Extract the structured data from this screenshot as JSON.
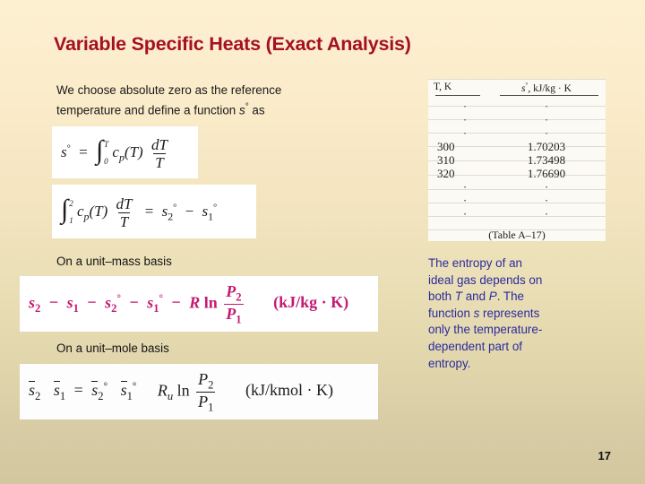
{
  "slide": {
    "title": "Variable Specific Heats (Exact Analysis)",
    "page_number": "17",
    "colors": {
      "title": "#a51022",
      "background_top": "#fdf0d0",
      "background_bottom": "#d2c79f",
      "magenta_equation": "#c31a72",
      "blue_text": "#2b2b9e"
    }
  },
  "intro": {
    "line1": "We choose absolute zero as the reference",
    "line2_pre": "temperature and define a function ",
    "line2_sym": "s",
    "line2_sup": "°",
    "line2_post": " as"
  },
  "equations": {
    "eq1": {
      "lhs": "s",
      "lhs_sup": "°",
      "equals": "=",
      "integral": "∫",
      "upper_limit": "T",
      "lower_limit": "0",
      "integrand": "c",
      "integrand_sub": "p",
      "integrand_arg": "(T)",
      "frac_num": "dT",
      "frac_den": "T"
    },
    "eq2": {
      "integral": "∫",
      "upper_limit": "2",
      "lower_limit": "1",
      "integrand": "c",
      "integrand_sub": "p",
      "integrand_arg": "(T)",
      "frac_num": "dT",
      "frac_den": "T",
      "equals": "=",
      "rhs1": "s",
      "rhs1_sub": "2",
      "rhs1_sup": "°",
      "minus": "−",
      "rhs2": "s",
      "rhs2_sub": "1",
      "rhs2_sup": "°"
    },
    "eq3": {
      "t1": "s",
      "t1_sub": "2",
      "op1": "−",
      "t2": "s",
      "t2_sub": "1",
      "op2": "−",
      "t3": "s",
      "t3_sub": "2",
      "t3_sup": "°",
      "op3": "−",
      "t4": "s",
      "t4_sub": "1",
      "t4_sup": "°",
      "op4": "−",
      "R": "R",
      "ln": "ln",
      "frac_num": "P",
      "frac_num_sub": "2",
      "frac_den": "P",
      "frac_den_sub": "1",
      "units": "(kJ/kg · K)"
    },
    "eq4": {
      "t1": "s",
      "t1_sub": "2",
      "op1": "",
      "t2": "s",
      "t2_sub": "1",
      "op2": "=",
      "t3": "s",
      "t3_sub": "2",
      "t3_sup": "°",
      "op3": "",
      "t4": "s",
      "t4_sub": "1",
      "t4_sup": "°",
      "R": "R",
      "R_sub": "u",
      "ln": "ln",
      "frac_num": "P",
      "frac_num_sub": "2",
      "frac_den": "P",
      "frac_den_sub": "1",
      "units": "(kJ/kmol · K)"
    }
  },
  "labels": {
    "unit_mass": "On a unit–mass basis",
    "unit_mole": "On a unit–mole basis"
  },
  "table": {
    "header": {
      "col1": "T, K",
      "col2_sym": "s",
      "col2_sup": "°",
      "col2_rest": ", kJ/kg · K"
    },
    "dots": "·",
    "rows": [
      {
        "t": "300",
        "s": "1.70203"
      },
      {
        "t": "310",
        "s": "1.73498"
      },
      {
        "t": "320",
        "s": "1.76690"
      }
    ],
    "caption": "(Table A–17)"
  },
  "blue_note": {
    "l1": "The entropy of an",
    "l2": "ideal gas depends on",
    "l3_pre": "both ",
    "l3_t": "T",
    "l3_mid": " and ",
    "l3_p": "P",
    "l3_post": ". The",
    "l4_pre": "function ",
    "l4_s": "s",
    "l4_post": " represents",
    "l5": "only the temperature-",
    "l6": "dependent part of",
    "l7": "entropy."
  }
}
